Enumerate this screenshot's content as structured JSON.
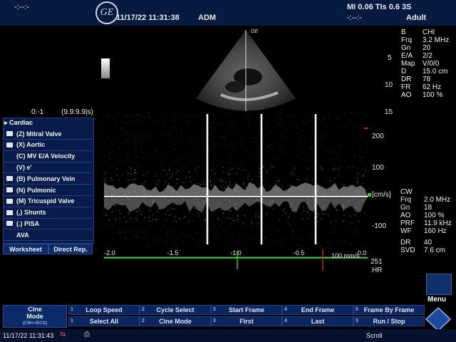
{
  "header": {
    "left_text": "-:--:-",
    "datetime": "11/17/22 11:31:38",
    "operator": "ADM",
    "mi_ti": "MI 0.06  TIs 0.6  3S",
    "time_field": "-:--:-",
    "patient_type": "Adult",
    "logo_text": "GE"
  },
  "image_params": {
    "labels": [
      "B",
      "Frq",
      "Gn",
      "E/A",
      "Map",
      "D",
      "DR",
      "FR",
      "AO"
    ],
    "values": [
      "CHI",
      "3.2 MHz",
      "20",
      "2/2",
      "V/0/0",
      "15.0 cm",
      "78",
      "62 Hz",
      "100 %"
    ]
  },
  "depth_scale": [
    "5",
    "10",
    "15"
  ],
  "doppler_params": {
    "labels": [
      "CW",
      "Frq",
      "Gn",
      "AO",
      "PRF",
      "WF",
      "DR",
      "SVD"
    ],
    "values": [
      "",
      "2.0 MHz",
      "18",
      "100 %",
      "11.9 kHz",
      "160 Hz",
      "40",
      "7.6 cm"
    ]
  },
  "velocity_scale": {
    "ticks": [
      "200",
      "100",
      "-100"
    ],
    "unit": "[cm/s]"
  },
  "time_axis": {
    "ticks": [
      "-2.0",
      "-1.5",
      "-1.0",
      "-0.5",
      "0.0"
    ],
    "scale_label": "100 mm/s"
  },
  "heart_rate": {
    "value": "251",
    "label": "HR"
  },
  "sector_label": "GE",
  "cine": {
    "counter": "0:-1",
    "range": "(9.9:9.9|s)"
  },
  "protocol": {
    "title": "Cardiac",
    "items": [
      "(Z)  Mitral Valve",
      "(X)  Aortic",
      "(C)  MV E/A Velocity",
      "(V)  e'",
      "(B)  Pulmonary Vein",
      "(N)  Pulmonic",
      "(M)  Tricuspid Valve",
      "(,)  Shunts",
      "(.)  PISA",
      "AVA"
    ],
    "has_folder": [
      true,
      true,
      false,
      false,
      true,
      true,
      true,
      true,
      true,
      false
    ]
  },
  "buttons": {
    "worksheet": "Worksheet",
    "direct_rep": "Direct Rep."
  },
  "softkeys": {
    "mode": "Cine\nMode",
    "mode_sub": "(CW<>ECG)",
    "row1": [
      {
        "n": "1",
        "label": "Loop Speed"
      },
      {
        "n": "2",
        "label": "Cycle Select"
      },
      {
        "n": "3",
        "label": "Start Frame"
      },
      {
        "n": "4",
        "label": "End Frame"
      },
      {
        "n": "5",
        "label": "Frame By Frame"
      }
    ],
    "row2": [
      {
        "n": "1",
        "label": "Select All"
      },
      {
        "n": "2",
        "label": "Cine Mode"
      },
      {
        "n": "3",
        "label": "First"
      },
      {
        "n": "4",
        "label": "Last"
      },
      {
        "n": "5",
        "label": "Run / Stop"
      }
    ]
  },
  "menu_label": "Menu",
  "footer": {
    "datetime": "11/17/22 11:31:43",
    "scroll": "Scroll"
  }
}
